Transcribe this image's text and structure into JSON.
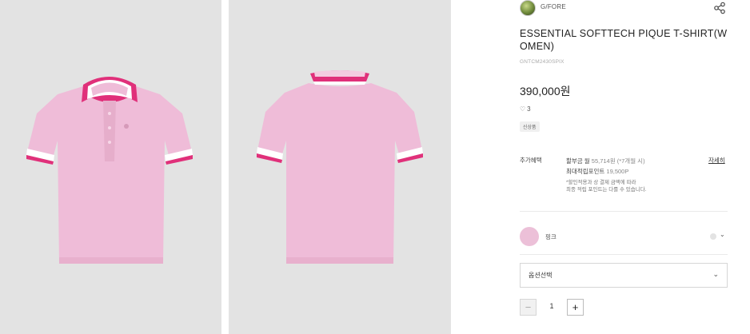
{
  "gallery": {
    "images": [
      {
        "name": "front",
        "shirt_color": "#efbcd8",
        "accent_color": "#e0307a"
      },
      {
        "name": "back",
        "shirt_color": "#efbcd8",
        "accent_color": "#e0307a"
      }
    ]
  },
  "brand": {
    "name": "G/FORE",
    "icon": "brand-logo-avatar"
  },
  "share": {
    "icon": "share-icon"
  },
  "product": {
    "title": "ESSENTIAL SOFTTECH PIQUE T-SHIRT(WOMEN)",
    "code": "GNTCM2430SPIX",
    "price": "390,000원",
    "likes": "3",
    "like_icon": "heart-icon",
    "tag": "신상품"
  },
  "benefits": {
    "label": "추가혜택",
    "installment": "할부금 월 55,714원 (*7개월 시)",
    "installment_prefix": "할부금 월",
    "installment_value": "55,714원 (*7개월 시)",
    "points_prefix": "최대적립포인트",
    "points_value": "19,500P",
    "note_line1": "*할인적용과 상 결제 금액에 따라",
    "note_line2": "최종 적립 포인트는 다를 수 있습니다.",
    "detail_link": "자세히"
  },
  "color_option": {
    "name": "핑크",
    "swatch_color": "#ecc0d8",
    "icon": "chevron-down-icon"
  },
  "option_select": {
    "placeholder": "옵션선택",
    "icon": "chevron-down-icon"
  },
  "quantity": {
    "value": "1",
    "minus": "−",
    "plus": "+"
  }
}
